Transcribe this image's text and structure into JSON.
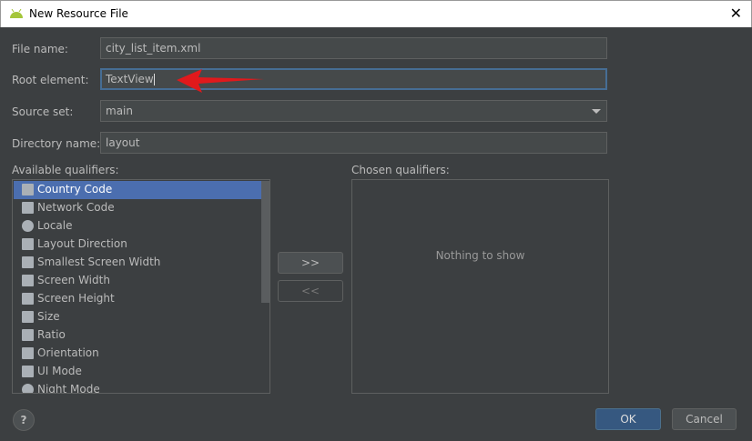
{
  "window": {
    "title": "New Resource File",
    "close": "✕"
  },
  "form": {
    "file_name_label": "File name:",
    "file_name": "city_list_item.xml",
    "root_element_label": "Root element:",
    "root_element": "TextView",
    "source_set_label": "Source set:",
    "source_set": "main",
    "directory_name_label": "Directory name:",
    "directory_name": "layout"
  },
  "qualifiers": {
    "available_label": "Available qualifiers:",
    "chosen_label": "Chosen qualifiers:",
    "chosen_empty": "Nothing to show",
    "add": ">>",
    "remove": "<<",
    "items": [
      {
        "label": "Country Code",
        "icon": "country-code-icon"
      },
      {
        "label": "Network Code",
        "icon": "network-code-icon"
      },
      {
        "label": "Locale",
        "icon": "globe-icon"
      },
      {
        "label": "Layout Direction",
        "icon": "arrow-left-icon"
      },
      {
        "label": "Smallest Screen Width",
        "icon": "arrows-all-icon"
      },
      {
        "label": "Screen Width",
        "icon": "arrows-horizontal-icon"
      },
      {
        "label": "Screen Height",
        "icon": "arrows-vertical-icon"
      },
      {
        "label": "Size",
        "icon": "resize-icon"
      },
      {
        "label": "Ratio",
        "icon": "ratio-icon"
      },
      {
        "label": "Orientation",
        "icon": "orientation-icon"
      },
      {
        "label": "UI Mode",
        "icon": "ui-mode-icon"
      },
      {
        "label": "Night Mode",
        "icon": "moon-icon"
      }
    ],
    "selected": "Country Code"
  },
  "footer": {
    "help": "?",
    "ok": "OK",
    "cancel": "Cancel"
  },
  "colors": {
    "accent": "#4b6eaf",
    "annotation_arrow": "#e0191c"
  }
}
